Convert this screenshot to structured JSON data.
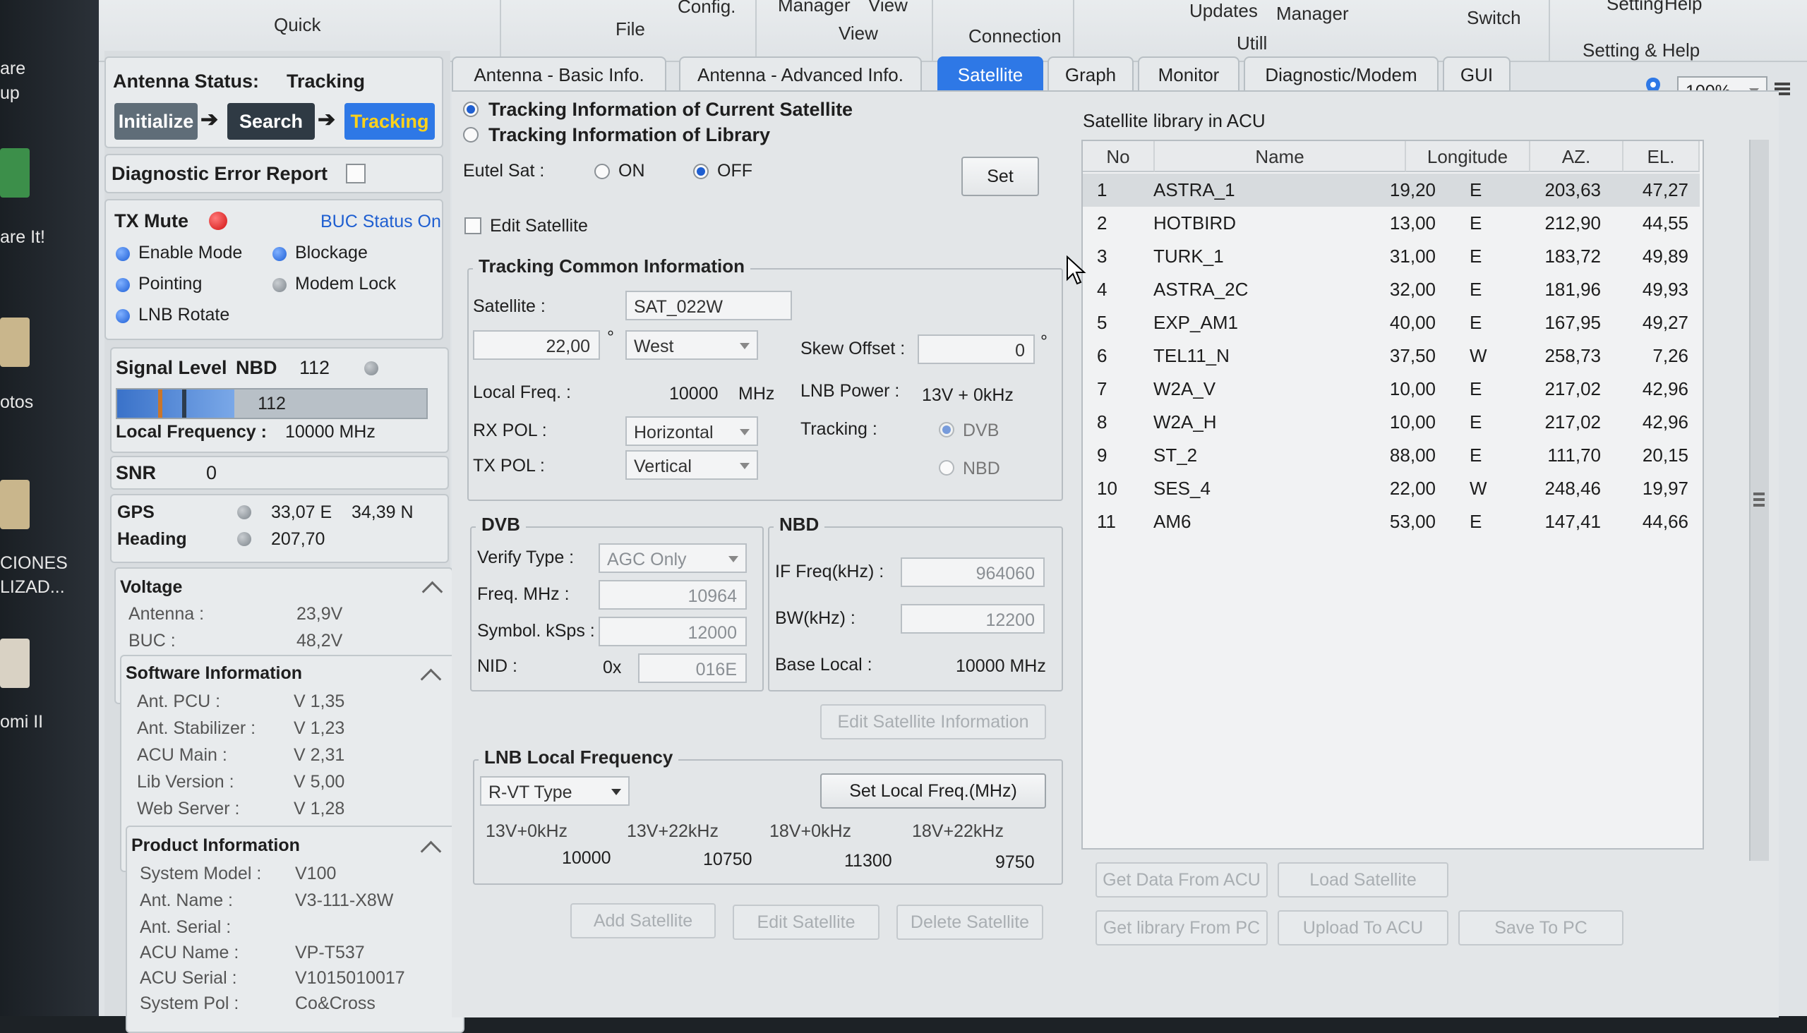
{
  "desktop": {
    "labels": [
      "are",
      "up",
      "are It!",
      "otos",
      "CIONES",
      "LIZAD...",
      "omi II"
    ]
  },
  "ribbon": {
    "groups": [
      {
        "label": "Quick"
      },
      {
        "label": "File"
      },
      {
        "label": "View"
      },
      {
        "label": "Connection"
      },
      {
        "label": "Utill"
      },
      {
        "label": "Setting & Help"
      }
    ],
    "items": [
      "Config.",
      "Manager",
      "View",
      "Updates",
      "Manager",
      "Switch",
      "Setting",
      "Help"
    ]
  },
  "status": {
    "antenna_status_label": "Antenna Status:",
    "antenna_status_value": "Tracking",
    "steps": [
      "Initialize",
      "Search",
      "Tracking"
    ],
    "diagnostic_label": "Diagnostic Error Report",
    "tx_mute": "TX Mute",
    "buc_status": "BUC Status On",
    "indicators": [
      "Enable Mode",
      "Blockage",
      "Pointing",
      "Modem Lock",
      "LNB Rotate"
    ],
    "signal_level_label": "Signal Level",
    "signal_mode": "NBD",
    "signal_value": "112",
    "signal_bar_value": "112",
    "signal_fraction": 0.38,
    "local_freq_label": "Local Frequency :",
    "local_freq_value": "10000 MHz",
    "snr_label": "SNR",
    "snr_value": "0",
    "gps_label": "GPS",
    "gps_lon": "33,07 E",
    "gps_lat": "34,39 N",
    "heading_label": "Heading",
    "heading_value": "207,70"
  },
  "voltage": {
    "title": "Voltage",
    "antenna_label": "Antenna :",
    "antenna_value": "23,9V",
    "buc_label": "BUC :",
    "buc_value": "48,2V"
  },
  "software": {
    "title": "Software Information",
    "rows": [
      {
        "label": "Ant. PCU :",
        "value": "V 1,35"
      },
      {
        "label": "Ant. Stabilizer :",
        "value": "V 1,23"
      },
      {
        "label": "ACU Main :",
        "value": "V 2,31"
      },
      {
        "label": "Lib Version :",
        "value": "V 5,00"
      },
      {
        "label": "Web Server :",
        "value": "V 1,28"
      }
    ]
  },
  "product": {
    "title": "Product Information",
    "rows": [
      {
        "label": "System Model :",
        "value": "V100"
      },
      {
        "label": "Ant. Name :",
        "value": "V3-111-X8W"
      },
      {
        "label": "Ant. Serial :",
        "value": ""
      },
      {
        "label": "ACU Name :",
        "value": "VP-T537"
      },
      {
        "label": "ACU Serial :",
        "value": "V1015010017"
      },
      {
        "label": "System Pol :",
        "value": "Co&Cross"
      }
    ]
  },
  "tabs": [
    "Antenna - Basic Info.",
    "Antenna - Advanced Info.",
    "Satellite",
    "Graph",
    "Monitor",
    "Diagnostic/Modem",
    "GUI"
  ],
  "zoom": "100%",
  "satellite": {
    "radio_current": "Tracking Information of Current Satellite",
    "radio_library": "Tracking Information of Library",
    "eutel_label": "Eutel Sat :",
    "eutel_on": "ON",
    "eutel_off": "OFF",
    "set_button": "Set",
    "edit_satellite": "Edit Satellite",
    "common_title": "Tracking Common  Information",
    "satellite_label": "Satellite :",
    "satellite_value": "SAT_022W",
    "longitude_value": "22,00",
    "degree": "°",
    "direction_value": "West",
    "skew_label": "Skew Offset :",
    "skew_value": "0",
    "local_freq_label": "Local Freq. :",
    "local_freq_value": "10000",
    "local_freq_unit": "MHz",
    "lnb_power_label": "LNB Power :",
    "lnb_power_value": "13V + 0kHz",
    "rx_pol_label": "RX POL :",
    "rx_pol_value": "Horizontal",
    "tx_pol_label": "TX POL :",
    "tx_pol_value": "Vertical",
    "tracking_label": "Tracking :",
    "tracking_dvb": "DVB",
    "tracking_nbd": "NBD",
    "dvb": {
      "title": "DVB",
      "verify_label": "Verify Type :",
      "verify_value": "AGC Only",
      "freq_label": "Freq. MHz :",
      "freq_value": "10964",
      "symbol_label": "Symbol. kSps :",
      "symbol_value": "12000",
      "nid_label": "NID :",
      "nid_prefix": "0x",
      "nid_value": "016E"
    },
    "nbd": {
      "title": "NBD",
      "if_label": "IF Freq(kHz) :",
      "if_value": "964060",
      "bw_label": "BW(kHz) :",
      "bw_value": "12200",
      "base_label": "Base Local :",
      "base_value": "10000 MHz"
    },
    "edit_info_button": "Edit Satellite Information",
    "lnb": {
      "title": "LNB Local Frequency",
      "type_value": "R-VT Type",
      "set_button": "Set Local Freq.(MHz)",
      "headers": [
        "13V+0kHz",
        "13V+22kHz",
        "18V+0kHz",
        "18V+22kHz"
      ],
      "values": [
        "10000",
        "10750",
        "11300",
        "9750"
      ]
    },
    "bottom_buttons": [
      "Add Satellite",
      "Edit Satellite",
      "Delete Satellite"
    ]
  },
  "library": {
    "title": "Satellite library in ACU",
    "columns": [
      "No",
      "Name",
      "Longitude",
      "AZ.",
      "EL."
    ],
    "rows": [
      {
        "no": "1",
        "name": "ASTRA_1",
        "lon": "19,20",
        "dir": "E",
        "az": "203,63",
        "el": "47,27"
      },
      {
        "no": "2",
        "name": "HOTBIRD",
        "lon": "13,00",
        "dir": "E",
        "az": "212,90",
        "el": "44,55"
      },
      {
        "no": "3",
        "name": "TURK_1",
        "lon": "31,00",
        "dir": "E",
        "az": "183,72",
        "el": "49,89"
      },
      {
        "no": "4",
        "name": "ASTRA_2C",
        "lon": "32,00",
        "dir": "E",
        "az": "181,96",
        "el": "49,93"
      },
      {
        "no": "5",
        "name": "EXP_AM1",
        "lon": "40,00",
        "dir": "E",
        "az": "167,95",
        "el": "49,27"
      },
      {
        "no": "6",
        "name": "TEL11_N",
        "lon": "37,50",
        "dir": "W",
        "az": "258,73",
        "el": "7,26"
      },
      {
        "no": "7",
        "name": "W2A_V",
        "lon": "10,00",
        "dir": "E",
        "az": "217,02",
        "el": "42,96"
      },
      {
        "no": "8",
        "name": "W2A_H",
        "lon": "10,00",
        "dir": "E",
        "az": "217,02",
        "el": "42,96"
      },
      {
        "no": "9",
        "name": "ST_2",
        "lon": "88,00",
        "dir": "E",
        "az": "111,70",
        "el": "20,15"
      },
      {
        "no": "10",
        "name": "SES_4",
        "lon": "22,00",
        "dir": "W",
        "az": "248,46",
        "el": "19,97"
      },
      {
        "no": "11",
        "name": "AM6",
        "lon": "53,00",
        "dir": "E",
        "az": "147,41",
        "el": "44,66"
      }
    ],
    "buttons_row1": [
      "Get Data From ACU",
      "Load Satellite"
    ],
    "buttons_row2": [
      "Get library From PC",
      "Upload To ACU",
      "Save To PC"
    ]
  }
}
